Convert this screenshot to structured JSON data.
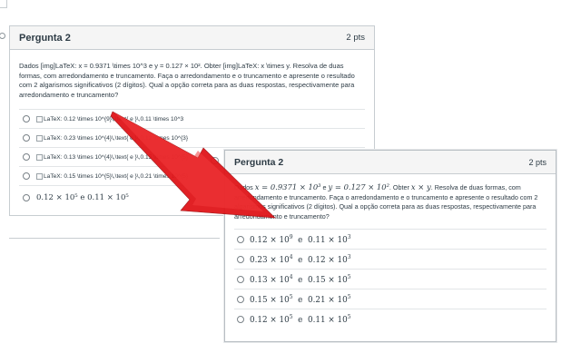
{
  "back_card": {
    "title": "Pergunta 2",
    "points": "2 pts",
    "question": "Dados [img]LaTeX: x = 0.9371 \\times 10^3 e y = 0.127 × 10². Obter [img]LaTeX: x \\times y. Resolva de duas formas, com arredondamento e truncamento. Faça o arredondamento e o truncamento e apresente o resultado com 2 algarismos significativos (2 dígitos). Qual a opção correta para as duas respostas, respectivamente para arredondamento e truncamento?",
    "answers": [
      {
        "alt": "LaTeX: 0.12 \\times 10^{9}\\,\\text{ e }\\,0.11 \\times 10^3"
      },
      {
        "alt": "LaTeX: 0.23 \\times 10^{4}\\,\\text{ e }\\,0.12 \\times 10^{3}"
      },
      {
        "alt": "LaTeX: 0.13 \\times 10^{4}\\,\\text{ e }\\,0.15 \\times 10^{5}"
      },
      {
        "alt": "LaTeX: 0.15 \\times 10^{5}\\,\\text{ e }\\,0.21 \\times 10^{5}"
      }
    ],
    "last_answer": "0.12 × 10⁵  e  0.11 × 10⁵"
  },
  "front_card": {
    "title": "Pergunta 2",
    "points": "2 pts",
    "question_parts": {
      "dados": "Dados",
      "x_expr": "x = 0.9371 × 10³",
      "e": "e",
      "y_expr": "y = 0.127 × 10²",
      "obter": ". Obter",
      "xy": "x × y",
      "rest": ". Resolva de duas formas, com arredondamento e truncamento. Faça o arredondamento e o truncamento e apresente o resultado com 2 algarismos significativos (2 dígitos). Qual a opção correta para as duas respostas, respectivamente para arredondamento e truncamento?"
    },
    "answers": [
      {
        "a": "0.12 × 10",
        "ae": "9",
        "mid": "e",
        "b": "0.11 × 10",
        "be": "3"
      },
      {
        "a": "0.23 × 10",
        "ae": "4",
        "mid": "e",
        "b": "0.12 × 10",
        "be": "3"
      },
      {
        "a": "0.13 × 10",
        "ae": "4",
        "mid": "e",
        "b": "0.15 × 10",
        "be": "5"
      },
      {
        "a": "0.15 × 10",
        "ae": "5",
        "mid": "e",
        "b": "0.21 × 10",
        "be": "5"
      },
      {
        "a": "0.12 × 10",
        "ae": "5",
        "mid": "e",
        "b": "0.11 × 10",
        "be": "5"
      }
    ]
  },
  "colors": {
    "arrow": "#e0161a",
    "border": "#c7cdd1",
    "header_bg": "#f5f5f5",
    "text": "#2d3b45"
  }
}
